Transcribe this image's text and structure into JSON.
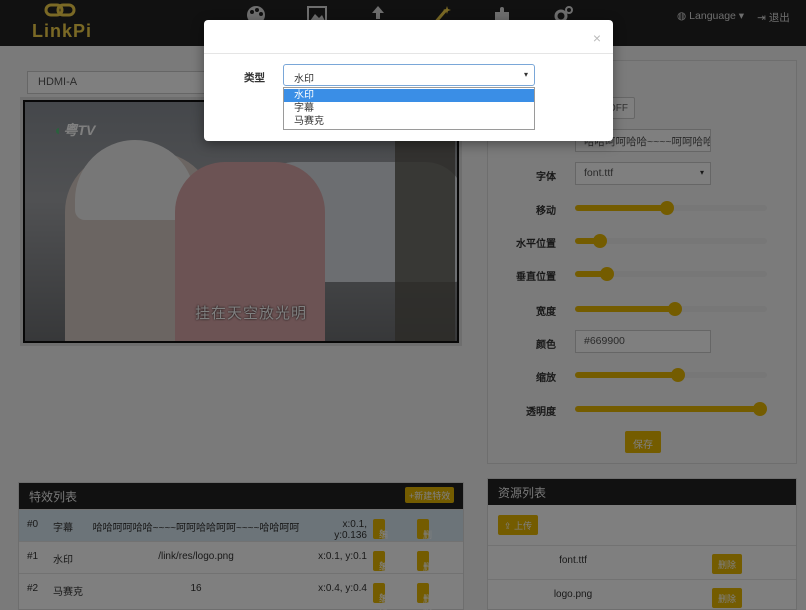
{
  "app": {
    "logo_text": "LinkPi"
  },
  "topbar": {
    "language_label": "Language",
    "logout_label": "退出",
    "icons": [
      "palette-icon",
      "image-icon",
      "upload-icon",
      "magic-wand-icon",
      "puzzle-icon",
      "cogs-icon"
    ]
  },
  "source_select": {
    "value": "HDMI-A"
  },
  "preview": {
    "watermark": "粤TV",
    "subtitle": "挂在天空放光明"
  },
  "settings": {
    "toggle_label": "OFF",
    "text_value": "哈哈呵呵哈哈~~~~呵呵哈哈",
    "font_label": "字体",
    "font_value": "font.ttf",
    "move_label": "移动",
    "h_pos_label": "水平位置",
    "v_pos_label": "垂直位置",
    "width_label": "宽度",
    "color_label": "颜色",
    "color_value": "#669900",
    "scale_label": "缩放",
    "opacity_label": "透明度",
    "save_label": "保存",
    "move_value": 0.48,
    "h_pos_value": 0.1,
    "v_pos_value": 0.14,
    "width_value": 0.52,
    "scale_value": 0.54,
    "opacity_value": 1.0
  },
  "effects": {
    "title": "特效列表",
    "new_label": "+新建特效",
    "edit_label": "编辑",
    "delete_label": "删除",
    "rows": [
      {
        "id": "#0",
        "type": "字幕",
        "content": "哈哈呵呵哈哈~~~~呵呵哈哈呵呵~~~~哈哈呵呵",
        "pos": "x:0.1, y:0.136"
      },
      {
        "id": "#1",
        "type": "水印",
        "content": "/link/res/logo.png",
        "pos": "x:0.1, y:0.1"
      },
      {
        "id": "#2",
        "type": "马赛克",
        "content": "16",
        "pos": "x:0.4, y:0.4"
      }
    ]
  },
  "resources": {
    "title": "资源列表",
    "upload_label": "上传",
    "delete_label": "删除",
    "files": [
      "font.ttf",
      "logo.png"
    ]
  },
  "modal": {
    "close_label": "×",
    "type_label": "类型",
    "selected": "水印",
    "options": [
      "水印",
      "字幕",
      "马赛克"
    ]
  },
  "colors": {
    "accent": "#e8b800",
    "topbar": "#222222",
    "option_highlight": "#3a8ee6"
  }
}
